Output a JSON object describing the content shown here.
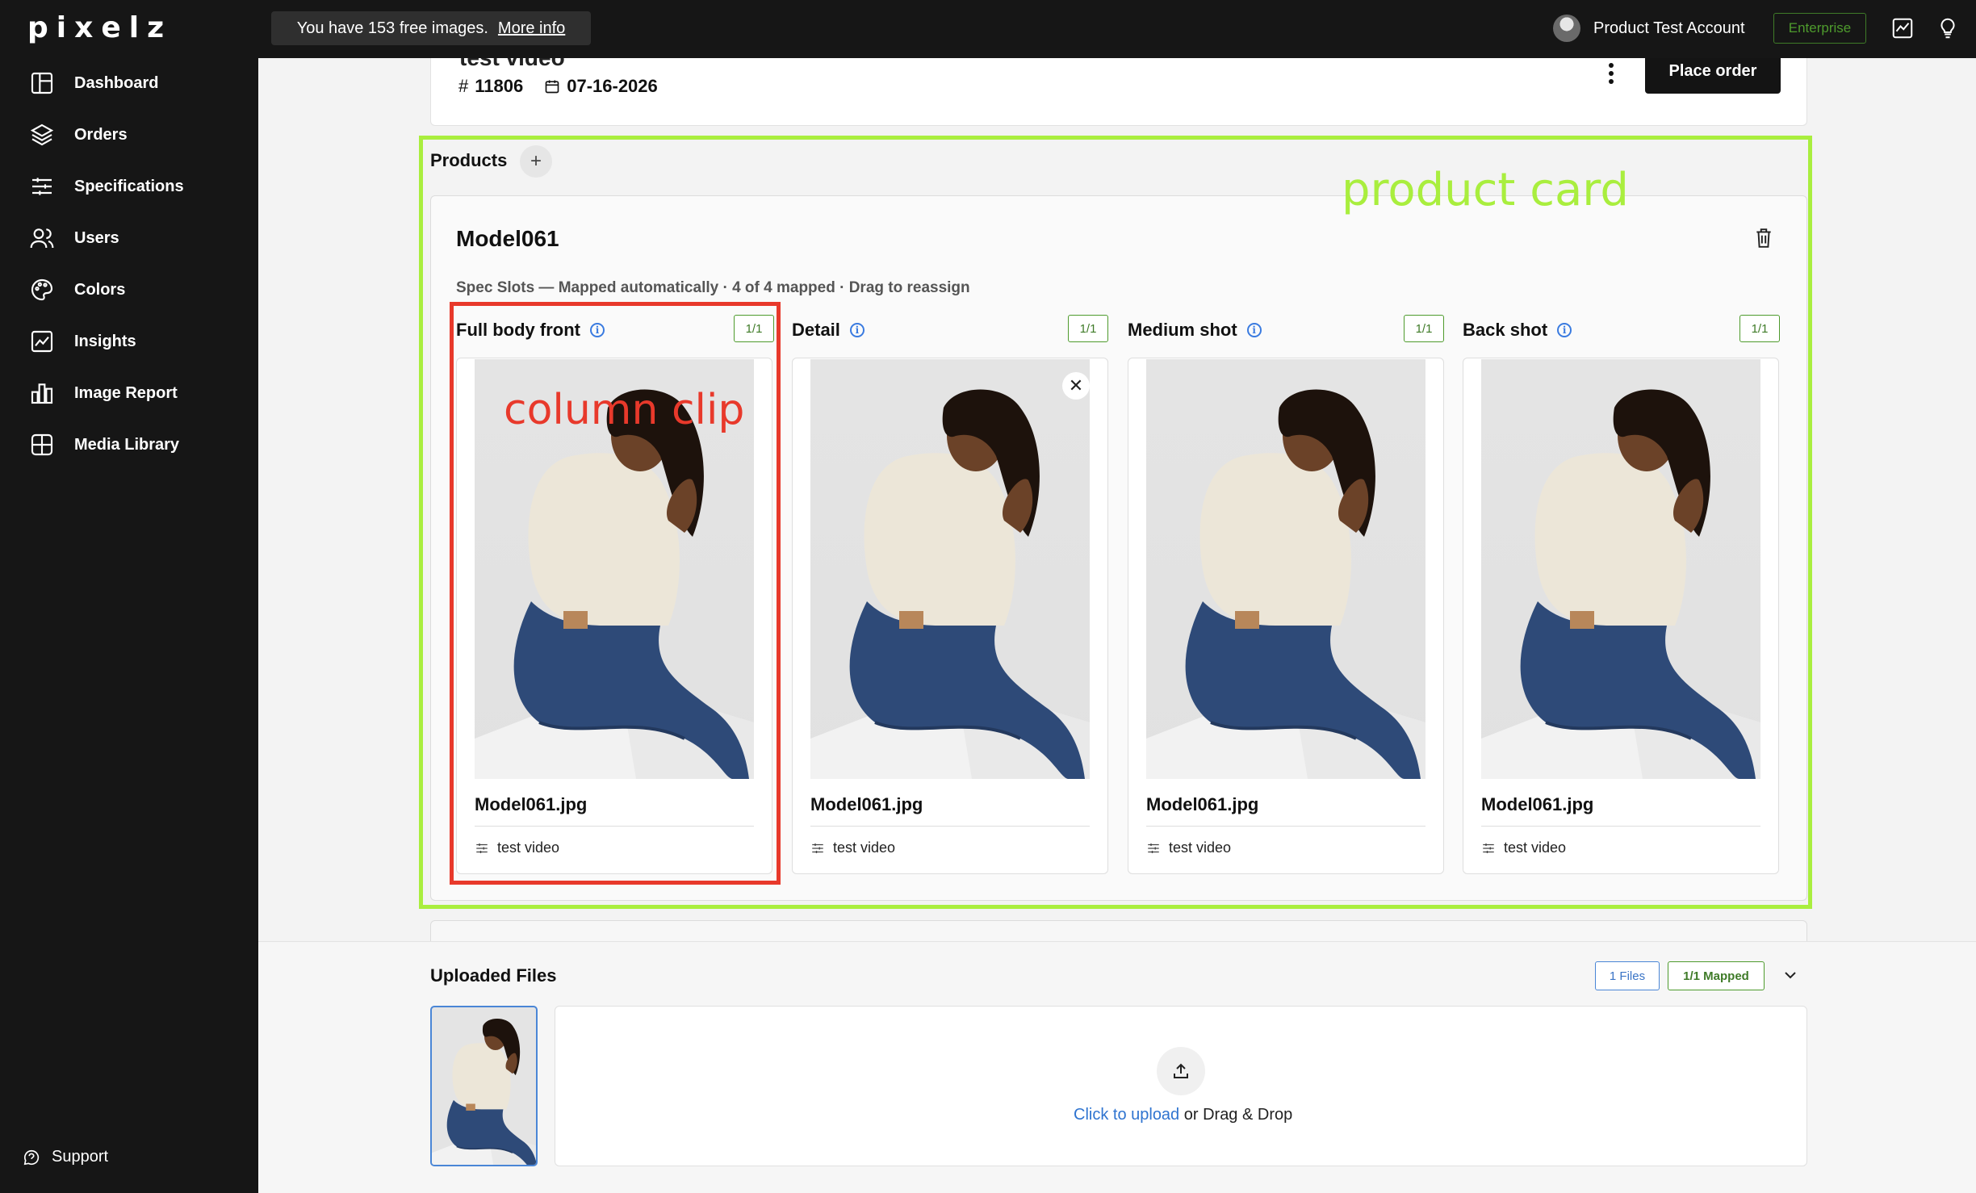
{
  "app": {
    "logo": "pixelz"
  },
  "topbar": {
    "banner_text": "You have 153 free images.",
    "banner_link": "More info",
    "account_name": "Product Test Account",
    "plan_badge": "Enterprise"
  },
  "sidebar": {
    "items": [
      {
        "label": "Dashboard",
        "icon": "dashboard-icon"
      },
      {
        "label": "Orders",
        "icon": "layers-icon"
      },
      {
        "label": "Specifications",
        "icon": "sliders-icon"
      },
      {
        "label": "Users",
        "icon": "users-icon"
      },
      {
        "label": "Colors",
        "icon": "palette-icon"
      },
      {
        "label": "Insights",
        "icon": "chart-icon"
      },
      {
        "label": "Image Report",
        "icon": "bar-chart-icon"
      },
      {
        "label": "Media Library",
        "icon": "grid-icon"
      }
    ],
    "support_label": "Support"
  },
  "order": {
    "title": "test video",
    "number": "11806",
    "date": "07-16-2026",
    "place_order_label": "Place order"
  },
  "products": {
    "label": "Products",
    "add_label": "+",
    "card": {
      "model": "Model061",
      "spec_line": "Spec Slots — Mapped automatically · 4 of 4 mapped · Drag to reassign",
      "slots": [
        {
          "name": "Full body front",
          "count": "1/1",
          "file": "Model061.jpg",
          "tag": "test video"
        },
        {
          "name": "Detail",
          "count": "1/1",
          "file": "Model061.jpg",
          "tag": "test video"
        },
        {
          "name": "Medium shot",
          "count": "1/1",
          "file": "Model061.jpg",
          "tag": "test video"
        },
        {
          "name": "Back shot",
          "count": "1/1",
          "file": "Model061.jpg",
          "tag": "test video"
        }
      ]
    }
  },
  "uploaded": {
    "title": "Uploaded Files",
    "files_badge": "1 Files",
    "mapped_badge": "1/1 Mapped",
    "upload_link": "Click to upload",
    "upload_rest": " or Drag & Drop"
  },
  "annotations": {
    "product_card": "product card",
    "column_clip": "column clip"
  },
  "colors": {
    "annotation_green": "#a9ee3e",
    "annotation_red": "#e8392b",
    "link_blue": "#2f74d0",
    "badge_green": "#3f7b28"
  }
}
